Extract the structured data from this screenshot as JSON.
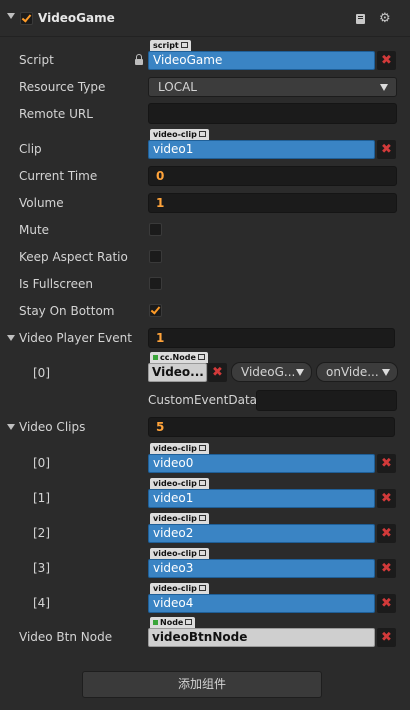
{
  "component": {
    "title": "VideoGame",
    "enabled": true
  },
  "props": {
    "script": {
      "label": "Script",
      "tag": "script",
      "value": "VideoGame"
    },
    "resource_type": {
      "label": "Resource Type",
      "value": "LOCAL"
    },
    "remote_url": {
      "label": "Remote URL",
      "value": ""
    },
    "clip": {
      "label": "Clip",
      "tag": "video-clip",
      "value": "video1"
    },
    "current_time": {
      "label": "Current Time",
      "value": "0"
    },
    "volume": {
      "label": "Volume",
      "value": "1"
    },
    "mute": {
      "label": "Mute",
      "checked": false
    },
    "keep_aspect_ratio": {
      "label": "Keep Aspect Ratio",
      "checked": false
    },
    "is_fullscreen": {
      "label": "Is Fullscreen",
      "checked": false
    },
    "stay_on_bottom": {
      "label": "Stay On Bottom",
      "checked": true
    },
    "video_player_event": {
      "label": "Video Player Event",
      "count": "1",
      "items": [
        {
          "index": "[0]",
          "node_tag": "cc.Node",
          "node": "Video...",
          "component": "VideoG...",
          "handler": "onVide...",
          "custom_label": "CustomEventData",
          "custom_value": ""
        }
      ]
    },
    "video_clips": {
      "label": "Video Clips",
      "count": "5",
      "items": [
        {
          "index": "[0]",
          "tag": "video-clip",
          "value": "video0"
        },
        {
          "index": "[1]",
          "tag": "video-clip",
          "value": "video1"
        },
        {
          "index": "[2]",
          "tag": "video-clip",
          "value": "video2"
        },
        {
          "index": "[3]",
          "tag": "video-clip",
          "value": "video3"
        },
        {
          "index": "[4]",
          "tag": "video-clip",
          "value": "video4"
        }
      ]
    },
    "video_btn_node": {
      "label": "Video Btn Node",
      "tag": "Node",
      "value": "videoBtnNode"
    }
  },
  "footer": {
    "add_component": "添加组件"
  },
  "colors": {
    "background": "#2b2b2b",
    "asset_field": "#3a84c4",
    "number": "#ffa33a",
    "checkmark": "#ff9c28",
    "clear_x": "#d23a3a"
  },
  "icons": [
    "collapse-arrow-icon",
    "checkmark-icon",
    "book-icon",
    "gear-icon",
    "lock-icon",
    "external-link-icon",
    "clear-x-icon",
    "dropdown-arrow-icon"
  ]
}
